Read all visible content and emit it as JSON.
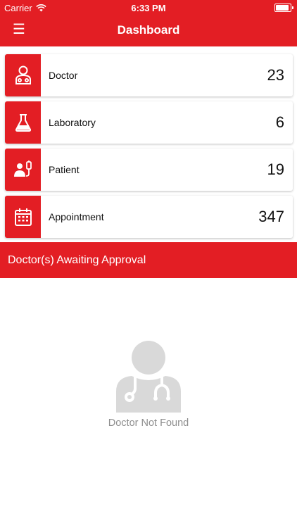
{
  "status_bar": {
    "carrier": "Carrier",
    "time": "6:33 PM"
  },
  "header": {
    "title": "Dashboard",
    "menu_icon": "☰"
  },
  "cards": [
    {
      "label": "Doctor",
      "count": "23",
      "icon": "doctor-icon"
    },
    {
      "label": "Laboratory",
      "count": "6",
      "icon": "flask-icon"
    },
    {
      "label": "Patient",
      "count": "19",
      "icon": "patient-icon"
    },
    {
      "label": "Appointment",
      "count": "347",
      "icon": "calendar-icon"
    }
  ],
  "approval": {
    "title": "Doctor(s) Awaiting Approval"
  },
  "empty_state": {
    "message": "Doctor Not Found",
    "icon": "doctor-placeholder-icon"
  },
  "colors": {
    "accent": "#e31e24",
    "muted": "#8e8e8e",
    "placeholder": "#d9d9d9"
  }
}
